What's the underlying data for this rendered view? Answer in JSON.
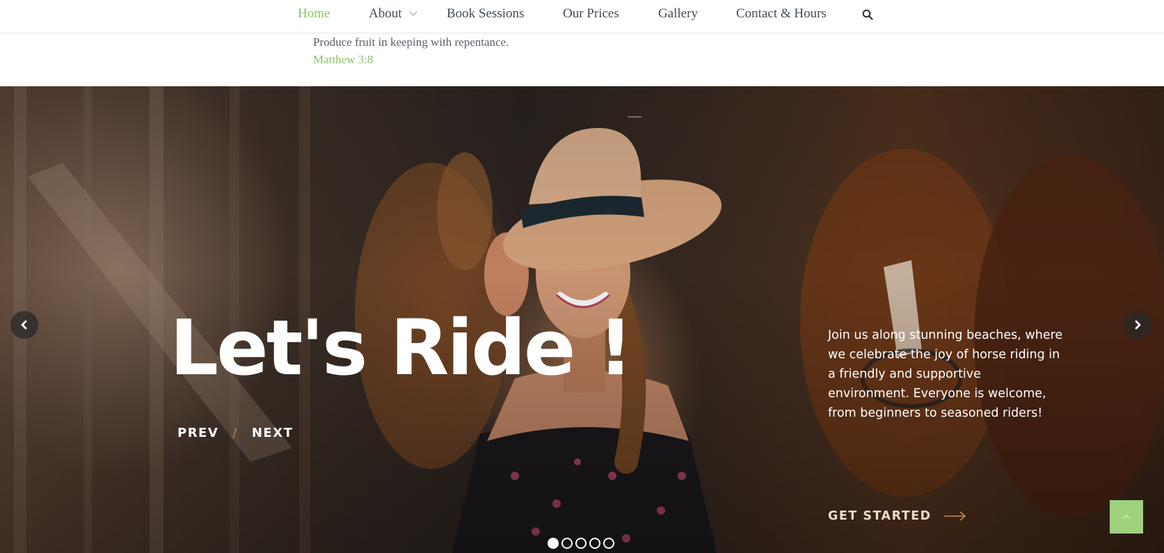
{
  "nav": {
    "items": [
      {
        "label": "Home",
        "active": true
      },
      {
        "label": "About",
        "has_dropdown": true
      },
      {
        "label": "Book Sessions"
      },
      {
        "label": "Our Prices"
      },
      {
        "label": "Gallery"
      },
      {
        "label": "Contact & Hours"
      }
    ],
    "search_icon": "search-icon"
  },
  "verse": {
    "text": "Produce fruit in keeping with repentance.",
    "reference": "Matthew 3:8"
  },
  "hero": {
    "title": "Let's Ride !",
    "prev_label": "PREV",
    "separator": "/",
    "next_label": "NEXT",
    "description": "Join us along stunning beaches, where we celebrate the joy of horse riding in a friendly and supportive environment. Everyone is welcome, from beginners to seasoned riders!",
    "cta_label": "GET STARTED",
    "slide_count": 5,
    "active_slide": 1
  },
  "colors": {
    "accent_green": "#8fbf6a",
    "to_top_bg": "#9fd17e",
    "cta_text": "#e9dcc8"
  }
}
